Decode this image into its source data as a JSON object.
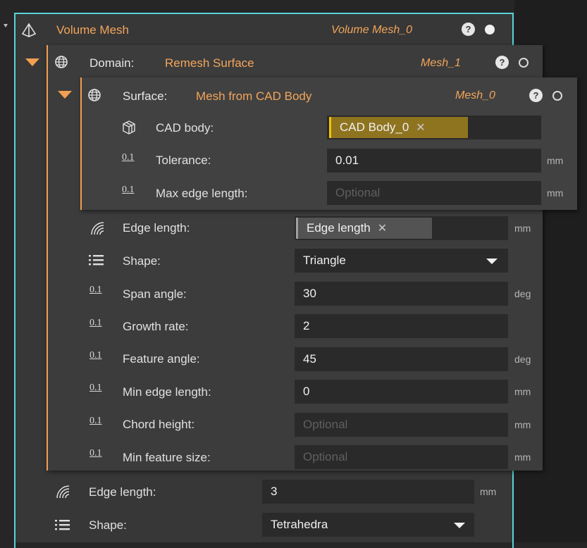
{
  "volume_mesh": {
    "title": "Volume Mesh",
    "ref": "Volume Mesh_0",
    "help": "?",
    "edge_length": {
      "label": "Edge length:",
      "value": "3",
      "unit": "mm"
    },
    "shape": {
      "label": "Shape:",
      "value": "Tetrahedra"
    }
  },
  "domain": {
    "label": "Domain:",
    "value": "Remesh Surface",
    "ref": "Mesh_1",
    "help": "?",
    "edge_length": {
      "label": "Edge length:",
      "chip": "Edge length",
      "unit": "mm"
    },
    "shape": {
      "label": "Shape:",
      "value": "Triangle"
    },
    "span_angle": {
      "label": "Span angle:",
      "value": "30",
      "unit": "deg"
    },
    "growth_rate": {
      "label": "Growth rate:",
      "value": "2"
    },
    "feature_angle": {
      "label": "Feature angle:",
      "value": "45",
      "unit": "deg"
    },
    "min_edge_length": {
      "label": "Min edge length:",
      "value": "0",
      "unit": "mm"
    },
    "chord_height": {
      "label": "Chord height:",
      "placeholder": "Optional",
      "unit": "mm"
    },
    "min_feature_size": {
      "label": "Min feature size:",
      "placeholder": "Optional",
      "unit": "mm"
    }
  },
  "surface": {
    "label": "Surface:",
    "value": "Mesh from CAD Body",
    "ref": "Mesh_0",
    "help": "?",
    "cad_body": {
      "label": "CAD body:",
      "chip": "CAD Body_0"
    },
    "tolerance": {
      "label": "Tolerance:",
      "value": "0.01",
      "unit": "mm"
    },
    "max_edge_length": {
      "label": "Max edge length:",
      "placeholder": "Optional",
      "unit": "mm"
    }
  },
  "icons": {
    "number": "0.1",
    "remove": "✕",
    "colors": {
      "accent": "#f0a050",
      "selection_border": "#59d2d9",
      "chip_yellow": "#8f7420"
    }
  }
}
